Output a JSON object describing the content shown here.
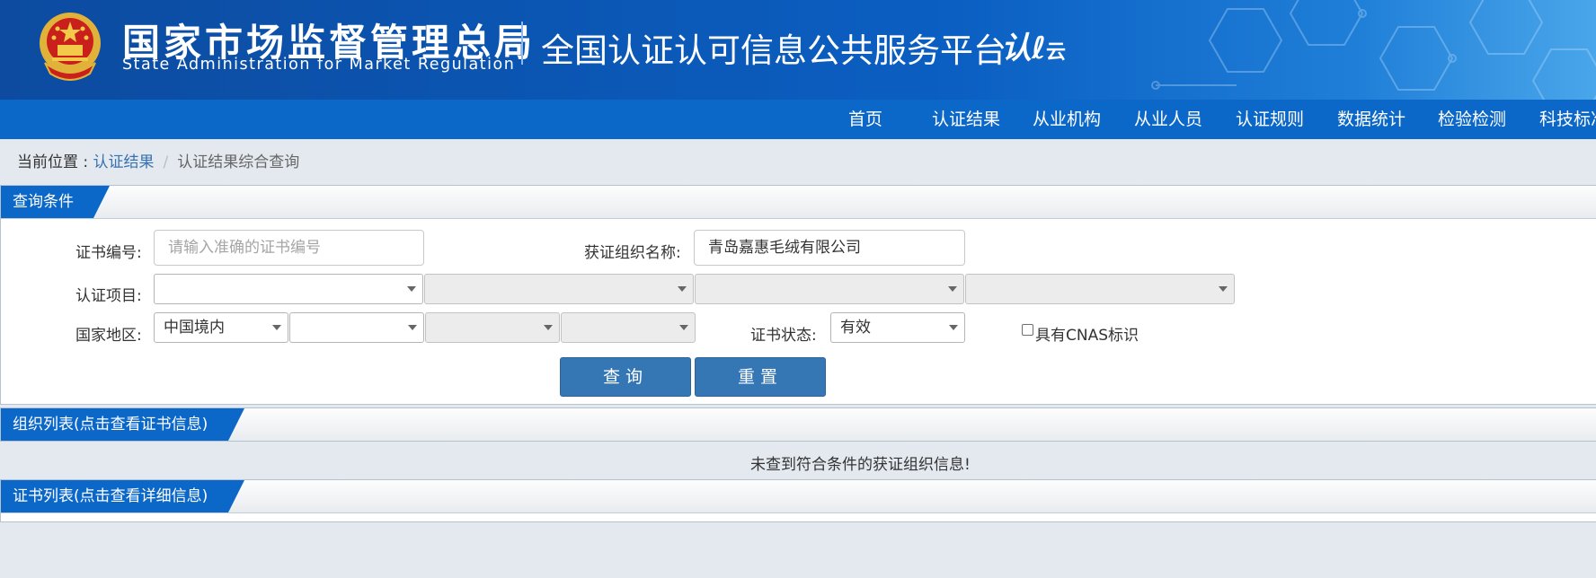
{
  "header": {
    "title_cn": "国家市场监督管理总局",
    "title_en": "State Administration  for  Market Regulation",
    "platform": "全国认证认可信息公共服务平台",
    "logo_main": "认",
    "logo_sub": "云",
    "emblem_icon": "national-emblem-icon"
  },
  "nav": {
    "items": [
      "首页",
      "认证结果",
      "从业机构",
      "从业人员",
      "认证规则",
      "数据统计",
      "检验检测",
      "科技标准"
    ]
  },
  "breadcrumb": {
    "prefix": "当前位置 : ",
    "link": "认证结果",
    "separator": "/",
    "current": "认证结果综合查询"
  },
  "query": {
    "tab_label": "查询条件",
    "cert_no_label": "证书编号:",
    "cert_no_placeholder": "请输入准确的证书编号",
    "org_name_label": "获证组织名称:",
    "org_name_value": "青岛嘉惠毛绒有限公司",
    "cert_item_label": "认证项目:",
    "cert_item_selects": [
      "",
      "",
      "",
      ""
    ],
    "region_label": "国家地区:",
    "region_selects": [
      "中国境内",
      "",
      "",
      ""
    ],
    "status_label": "证书状态:",
    "status_value": "有效",
    "cnas_label": "具有CNAS标识",
    "cnas_checked": false,
    "search_button": "查询",
    "reset_button": "重置"
  },
  "org_list": {
    "tab_label": "组织列表(点击查看证书信息)",
    "empty_message": "未查到符合条件的获证组织信息!"
  },
  "cert_list": {
    "tab_label": "证书列表(点击查看详细信息)"
  },
  "colors": {
    "header_blue": "#0b56b3",
    "nav_blue": "#0c68c8",
    "button_blue": "#3577b5",
    "link_blue": "#3772b0",
    "page_bg": "#e4e9ef"
  }
}
